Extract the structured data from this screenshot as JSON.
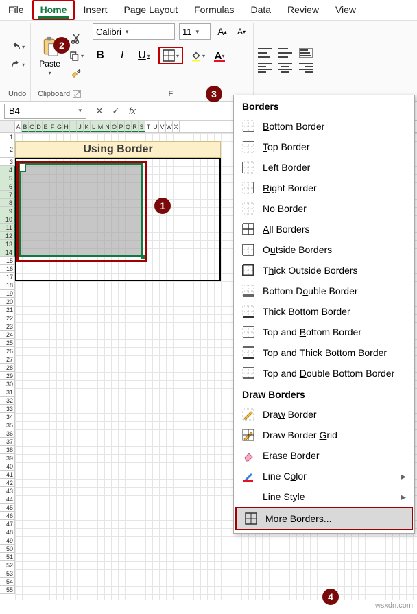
{
  "tabs": [
    "File",
    "Home",
    "Insert",
    "Page Layout",
    "Formulas",
    "Data",
    "Review",
    "View"
  ],
  "activeTab": "Home",
  "ribbon": {
    "undoGroup": "Undo",
    "clipboardGroup": "Clipboard",
    "pasteLabel": "Paste",
    "fontName": "Calibri",
    "fontSize": "11",
    "bold": "B",
    "italic": "I",
    "underline": "U"
  },
  "namebox": "B4",
  "fx": "fx",
  "columns": [
    "A",
    "B",
    "C",
    "D",
    "E",
    "F",
    "G",
    "H",
    "I",
    "J",
    "K",
    "L",
    "M",
    "N",
    "O",
    "P",
    "Q",
    "R",
    "S",
    "T",
    "U",
    "V",
    "W",
    "X"
  ],
  "titleCell": "Using Border",
  "bordersMenu": {
    "header1": "Borders",
    "items1": [
      "Bottom Border",
      "Top Border",
      "Left Border",
      "Right Border",
      "No Border",
      "All Borders",
      "Outside Borders",
      "Thick Outside Borders",
      "Bottom Double Border",
      "Thick Bottom Border",
      "Top and Bottom Border",
      "Top and Thick Bottom Border",
      "Top and Double Bottom Border"
    ],
    "header2": "Draw Borders",
    "items2": [
      "Draw Border",
      "Draw Border Grid",
      "Erase Border",
      "Line Color",
      "Line Style",
      "More Borders..."
    ]
  },
  "callouts": {
    "c1": "1",
    "c2": "2",
    "c3": "3",
    "c4": "4"
  },
  "watermark": "wsxdn.com"
}
